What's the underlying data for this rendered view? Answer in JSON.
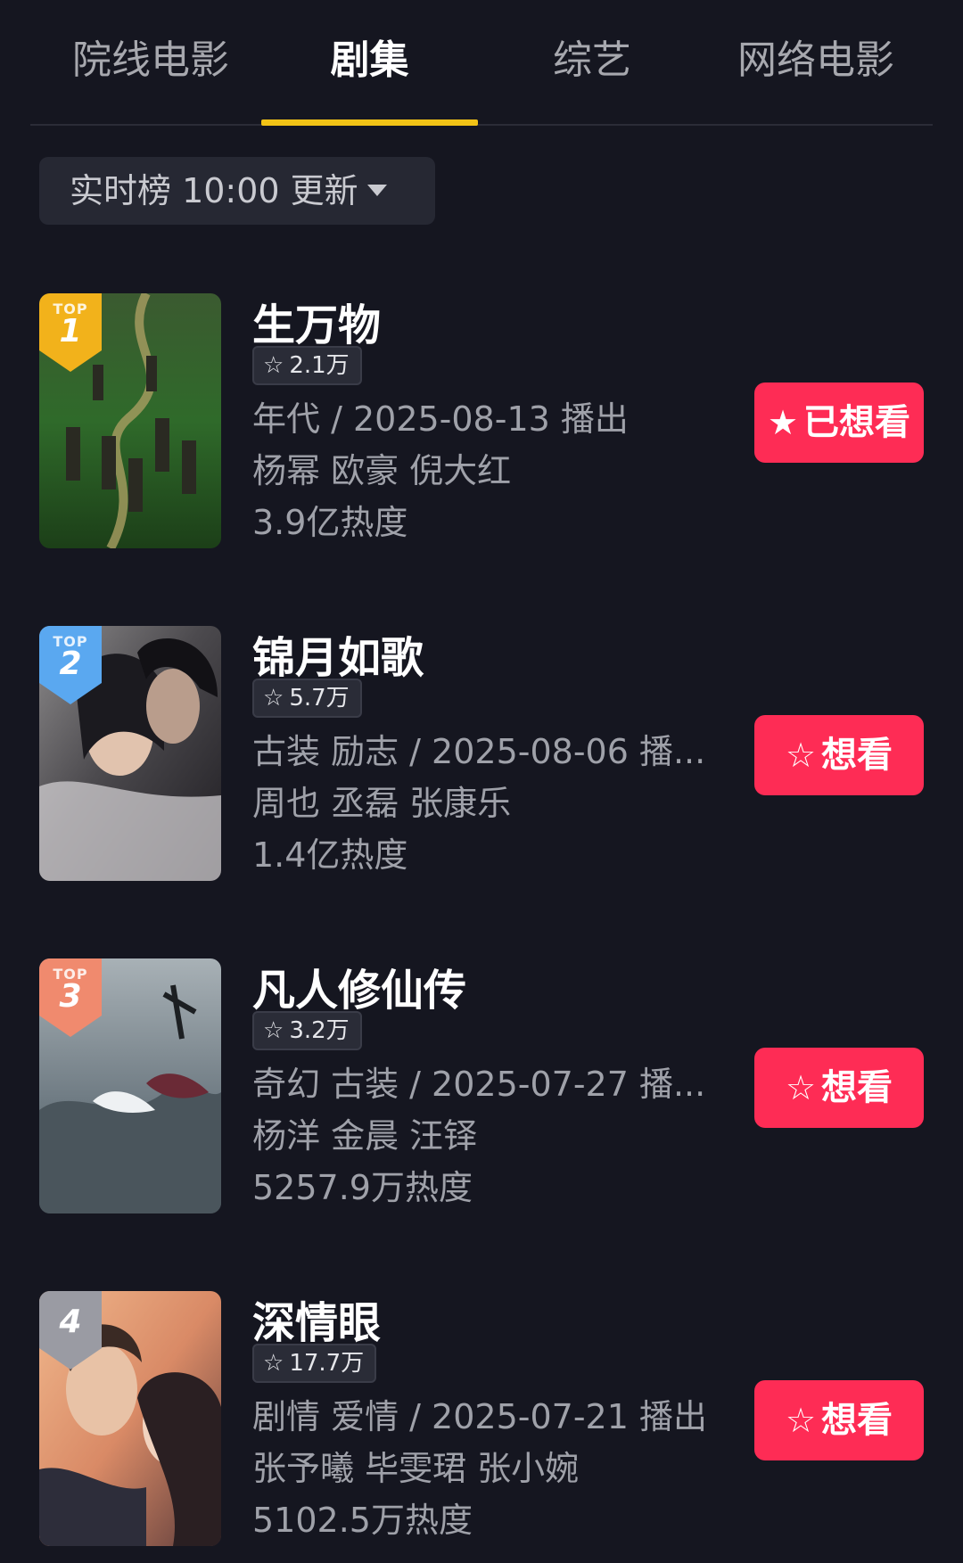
{
  "tabs": [
    {
      "label": "院线电影"
    },
    {
      "label": "剧集"
    },
    {
      "label": "综艺"
    },
    {
      "label": "网络电影"
    }
  ],
  "filter": {
    "label": "实时榜 10:00 更新"
  },
  "colors": {
    "background": "#151620",
    "accent_tab": "#f2c316",
    "button": "#fe2c55",
    "rank1": "#f2b21b",
    "rank2": "#5aa8f0",
    "rank3": "#f08a6e",
    "rank4": "#9a9ba3"
  },
  "items": [
    {
      "badge_top": "TOP",
      "rank": "1",
      "title": "生万物",
      "favorites": "2.1万",
      "meta": "年代 / 2025-08-13 播出",
      "cast": "杨幂 欧豪 倪大红",
      "heat": "3.9亿热度",
      "button": "已想看",
      "button_icon": "star-filled-icon"
    },
    {
      "badge_top": "TOP",
      "rank": "2",
      "title": "锦月如歌",
      "favorites": "5.7万",
      "meta": "古装 励志 / 2025-08-06 播...",
      "cast": "周也 丞磊 张康乐",
      "heat": "1.4亿热度",
      "button": "想看",
      "button_icon": "star-outline-icon"
    },
    {
      "badge_top": "TOP",
      "rank": "3",
      "title": "凡人修仙传",
      "favorites": "3.2万",
      "meta": "奇幻 古装 / 2025-07-27 播...",
      "cast": "杨洋 金晨 汪铎",
      "heat": "5257.9万热度",
      "button": "想看",
      "button_icon": "star-outline-icon"
    },
    {
      "badge_top": "",
      "rank": "4",
      "title": "深情眼",
      "favorites": "17.7万",
      "meta": "剧情 爱情 / 2025-07-21 播出",
      "cast": "张予曦 毕雯珺 张小婉",
      "heat": "5102.5万热度",
      "button": "想看",
      "button_icon": "star-outline-icon"
    }
  ]
}
